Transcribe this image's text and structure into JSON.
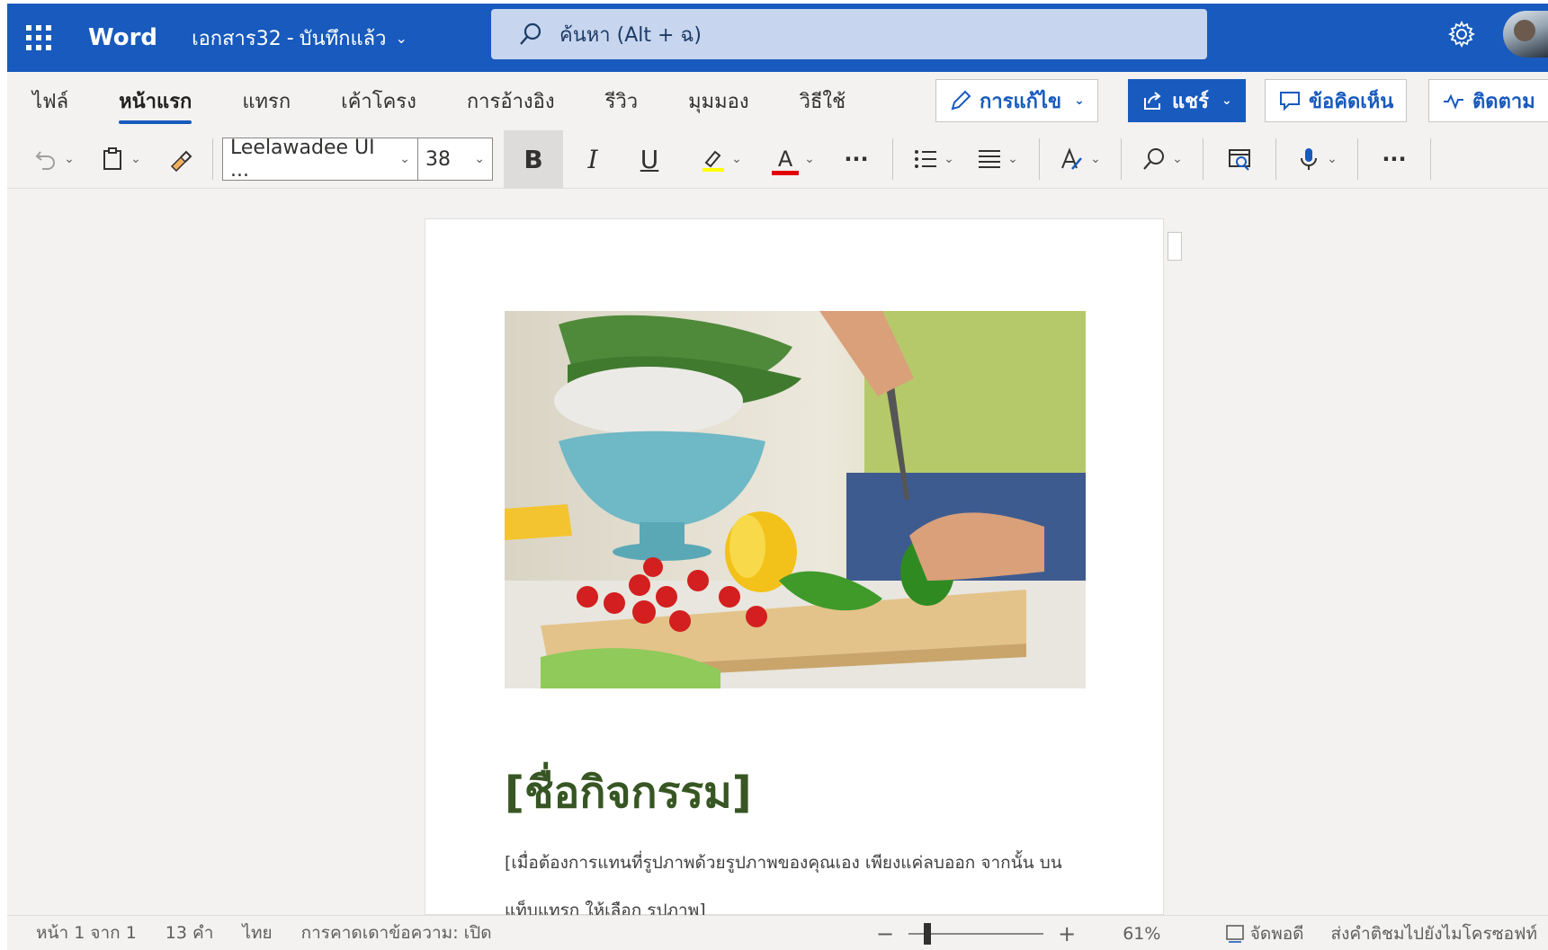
{
  "app": {
    "name": "Word"
  },
  "document": {
    "name": "เอกสาร32",
    "separator": "-",
    "save_status": "บันทึกแล้ว"
  },
  "search": {
    "placeholder": "ค้นหา (Alt + ฉ)"
  },
  "ribbon": {
    "tabs": [
      {
        "label": "ไฟล์",
        "active": false
      },
      {
        "label": "หน้าแรก",
        "active": true
      },
      {
        "label": "แทรก",
        "active": false
      },
      {
        "label": "เค้าโครง",
        "active": false
      },
      {
        "label": "การอ้างอิง",
        "active": false
      },
      {
        "label": "รีวิว",
        "active": false
      },
      {
        "label": "มุมมอง",
        "active": false
      },
      {
        "label": "วิธีใช้",
        "active": false
      }
    ],
    "editing_label": "การแก้ไข",
    "share_label": "แชร์",
    "comments_label": "ข้อคิดเห็น",
    "catchup_label": "ติดตาม"
  },
  "toolbar": {
    "font_name": "Leelawadee UI ...",
    "font_size": "38",
    "bold": "B",
    "italic": "I",
    "underline": "U",
    "font_color_letter": "A",
    "more": "···",
    "highlight_color": "#ffff00",
    "font_color": "#e00000"
  },
  "content": {
    "title": "[ชื่อกิจกรรม]",
    "body": "[เมื่อต้องการแทนที่รูปภาพด้วยรูปภาพของคุณเอง เพียงแค่ลบออก จากนั้น บนแท็บแทรก ให้เลือก รูปภาพ]"
  },
  "status": {
    "page": "หน้า 1 จาก 1",
    "words": "13 คำ",
    "language": "ไทย",
    "prediction": "การคาดเดาข้อความ: เปิด",
    "zoom_minus": "−",
    "zoom_plus": "+",
    "zoom_percent": "61%",
    "zoom_level": 0.61,
    "fit": "จัดพอดี",
    "feedback": "ส่งคำติชมไปยังไมโครซอฟท์"
  },
  "colors": {
    "brand": "#185abd",
    "title_green": "#375623"
  }
}
